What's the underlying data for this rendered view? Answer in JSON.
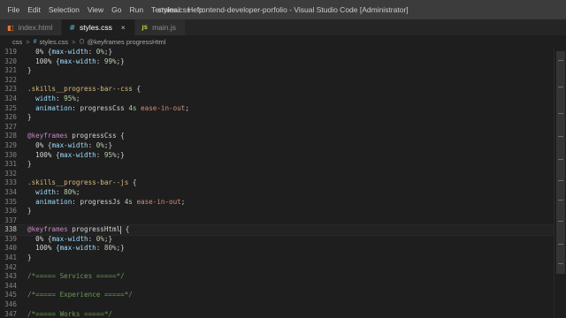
{
  "titlebar": {
    "menu": [
      "File",
      "Edit",
      "Selection",
      "View",
      "Go",
      "Run",
      "Terminal",
      "Help"
    ],
    "title": "styles.css - frontend-developer-porfolio - Visual Studio Code [Administrator]"
  },
  "tabs": [
    {
      "label": "index.html",
      "icon": "html-file-icon",
      "icon_glyph": "◧",
      "icon_color": "#e37933",
      "active": false
    },
    {
      "label": "styles.css",
      "icon": "css-file-icon",
      "icon_glyph": "#",
      "icon_color": "#519aba",
      "active": true,
      "close": "×"
    },
    {
      "label": "main.js",
      "icon": "js-file-icon",
      "icon_glyph": "JS",
      "icon_color": "#cbcb41",
      "active": false
    }
  ],
  "breadcrumb": {
    "folder": "css",
    "file": "styles.css",
    "symbol": "@keyframes progressHtml",
    "separator": ">"
  },
  "colors": {
    "selector": "#d7ba7d",
    "property": "#9cdcfe",
    "number": "#b5cea8",
    "at_rule": "#c586c0",
    "string_value": "#ce9178",
    "comment": "#6a9955"
  },
  "editor": {
    "current_line": 338,
    "lines": [
      {
        "n": "319",
        "tokens": [
          [
            "punc",
            "  0% {"
          ],
          [
            "prop",
            "max-width"
          ],
          [
            "punc",
            ": "
          ],
          [
            "num",
            "0%"
          ],
          [
            "punc",
            ";}"
          ]
        ]
      },
      {
        "n": "320",
        "tokens": [
          [
            "punc",
            "  100% {"
          ],
          [
            "prop",
            "max-width"
          ],
          [
            "punc",
            ": "
          ],
          [
            "num",
            "99%"
          ],
          [
            "punc",
            ";}"
          ]
        ]
      },
      {
        "n": "321",
        "tokens": [
          [
            "punc",
            "}"
          ]
        ]
      },
      {
        "n": "322",
        "tokens": []
      },
      {
        "n": "323",
        "tokens": [
          [
            "sel",
            ".skills__progress-bar--css"
          ],
          [
            "punc",
            " {"
          ]
        ]
      },
      {
        "n": "324",
        "tokens": [
          [
            "prop",
            "  width"
          ],
          [
            "punc",
            ": "
          ],
          [
            "num",
            "95%"
          ],
          [
            "punc",
            ";"
          ]
        ]
      },
      {
        "n": "325",
        "tokens": [
          [
            "prop",
            "  animation"
          ],
          [
            "punc",
            ": progressCss "
          ],
          [
            "num",
            "4s"
          ],
          [
            "punc",
            " "
          ],
          [
            "kw",
            "ease-in-out"
          ],
          [
            "punc",
            ";"
          ]
        ]
      },
      {
        "n": "326",
        "tokens": [
          [
            "punc",
            "}"
          ]
        ]
      },
      {
        "n": "327",
        "tokens": []
      },
      {
        "n": "328",
        "tokens": [
          [
            "at",
            "@keyframes"
          ],
          [
            "punc",
            " progressCss {"
          ]
        ]
      },
      {
        "n": "329",
        "tokens": [
          [
            "punc",
            "  0% {"
          ],
          [
            "prop",
            "max-width"
          ],
          [
            "punc",
            ": "
          ],
          [
            "num",
            "0%"
          ],
          [
            "punc",
            ";}"
          ]
        ]
      },
      {
        "n": "330",
        "tokens": [
          [
            "punc",
            "  100% {"
          ],
          [
            "prop",
            "max-width"
          ],
          [
            "punc",
            ": "
          ],
          [
            "num",
            "95%"
          ],
          [
            "punc",
            ";}"
          ]
        ]
      },
      {
        "n": "331",
        "tokens": [
          [
            "punc",
            "}"
          ]
        ]
      },
      {
        "n": "332",
        "tokens": []
      },
      {
        "n": "333",
        "tokens": [
          [
            "sel",
            ".skills__progress-bar--js"
          ],
          [
            "punc",
            " {"
          ]
        ]
      },
      {
        "n": "334",
        "tokens": [
          [
            "prop",
            "  width"
          ],
          [
            "punc",
            ": "
          ],
          [
            "num",
            "80%"
          ],
          [
            "punc",
            ";"
          ]
        ]
      },
      {
        "n": "335",
        "tokens": [
          [
            "prop",
            "  animation"
          ],
          [
            "punc",
            ": progressJs "
          ],
          [
            "num",
            "4s"
          ],
          [
            "punc",
            " "
          ],
          [
            "kw",
            "ease-in-out"
          ],
          [
            "punc",
            ";"
          ]
        ]
      },
      {
        "n": "336",
        "tokens": [
          [
            "punc",
            "}"
          ]
        ]
      },
      {
        "n": "337",
        "tokens": []
      },
      {
        "n": "338",
        "tokens": [
          [
            "at",
            "@keyframes"
          ],
          [
            "punc",
            " progressHtml"
          ],
          [
            "cursor",
            ""
          ],
          [
            "punc",
            " {"
          ]
        ]
      },
      {
        "n": "339",
        "tokens": [
          [
            "punc",
            "  0% {"
          ],
          [
            "prop",
            "max-width"
          ],
          [
            "punc",
            ": "
          ],
          [
            "num",
            "0%"
          ],
          [
            "punc",
            ";}"
          ]
        ]
      },
      {
        "n": "340",
        "tokens": [
          [
            "punc",
            "  100% {"
          ],
          [
            "prop",
            "max-width"
          ],
          [
            "punc",
            ": "
          ],
          [
            "num",
            "80%"
          ],
          [
            "punc",
            ";}"
          ]
        ]
      },
      {
        "n": "341",
        "tokens": [
          [
            "punc",
            "}"
          ]
        ]
      },
      {
        "n": "342",
        "tokens": []
      },
      {
        "n": "343",
        "tokens": [
          [
            "cmt",
            "/*===== Services =====*/"
          ]
        ]
      },
      {
        "n": "344",
        "tokens": []
      },
      {
        "n": "345",
        "tokens": [
          [
            "cmt",
            "/*===== Experience =====*/"
          ]
        ]
      },
      {
        "n": "346",
        "tokens": []
      },
      {
        "n": "347",
        "tokens": [
          [
            "cmt",
            "/*===== Works =====*/"
          ]
        ]
      }
    ]
  }
}
